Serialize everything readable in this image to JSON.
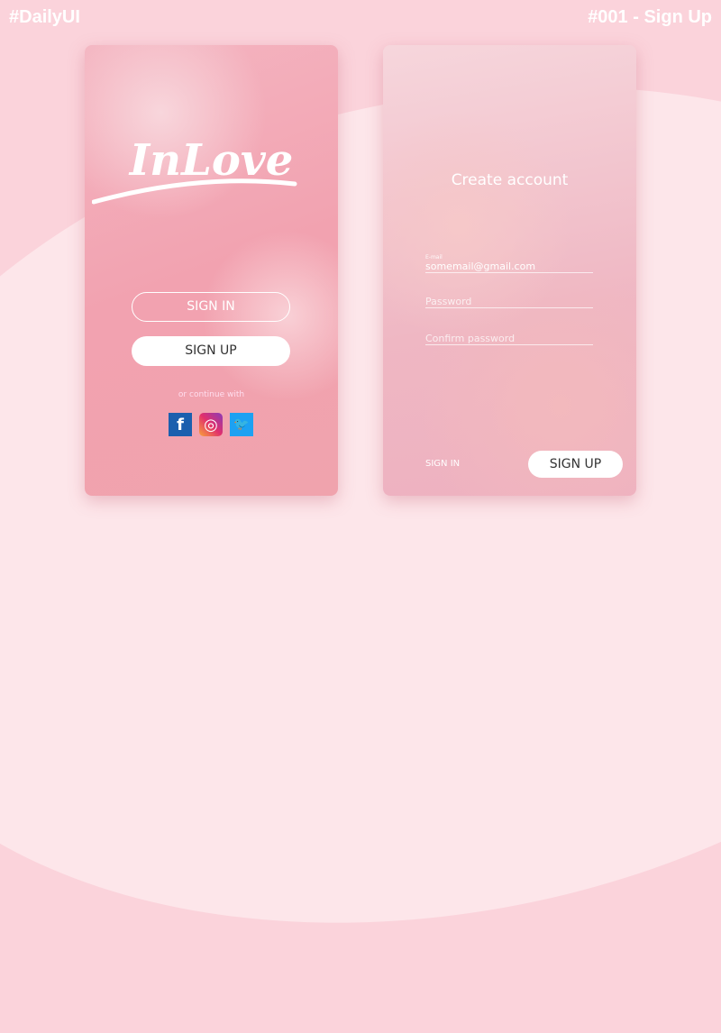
{
  "header": {
    "left": "#DailyUI",
    "right": "#001 - Sign Up"
  },
  "welcome": {
    "logo": "InLove",
    "sign_in": "SIGN IN",
    "sign_up": "SIGN UP",
    "continue": "or continue with",
    "social": [
      {
        "name": "facebook",
        "glyph": "f",
        "color": "#1b5fae"
      },
      {
        "name": "instagram",
        "glyph": "◎",
        "color": "#d9317a"
      },
      {
        "name": "twitter",
        "glyph": "🐦",
        "color": "#1da1f2"
      }
    ]
  },
  "signup": {
    "title": "Create account",
    "email_label": "E-mail",
    "email_value": "somemail@gmail.com",
    "password_placeholder": "Password",
    "confirm_placeholder": "Confirm password",
    "sign_in_link": "SIGN IN",
    "sign_up": "SIGN UP"
  }
}
